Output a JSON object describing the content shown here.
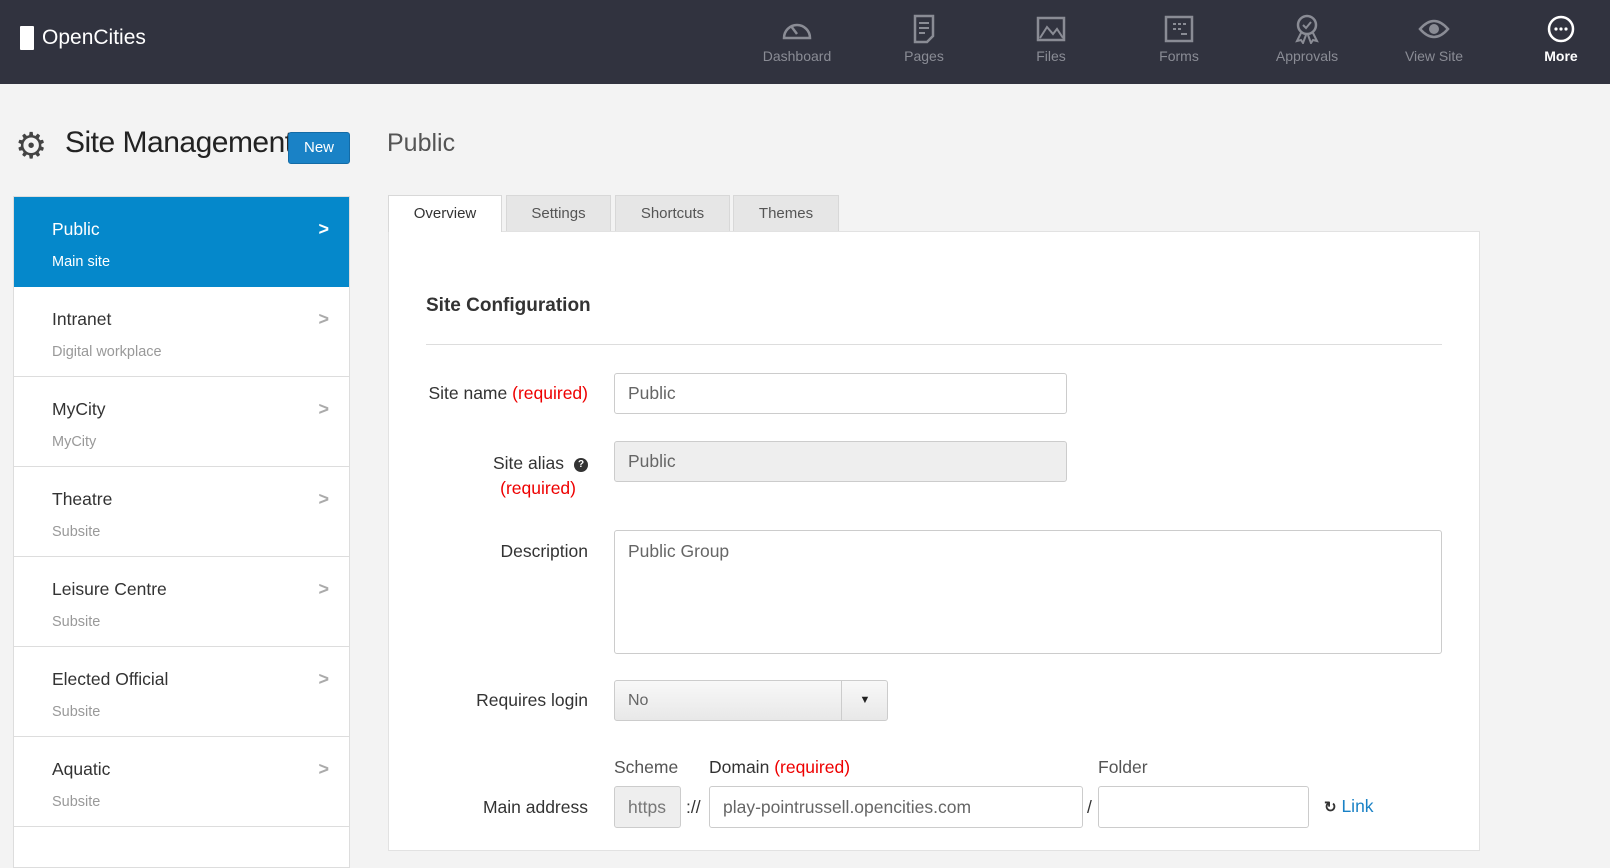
{
  "brand": "OpenCities",
  "nav": [
    {
      "label": "Dashboard",
      "icon": "dashboard-icon"
    },
    {
      "label": "Pages",
      "icon": "pages-icon"
    },
    {
      "label": "Files",
      "icon": "files-icon"
    },
    {
      "label": "Forms",
      "icon": "forms-icon"
    },
    {
      "label": "Approvals",
      "icon": "approvals-icon"
    },
    {
      "label": "View Site",
      "icon": "eye-icon"
    },
    {
      "label": "More",
      "icon": "more-icon"
    }
  ],
  "heading": "Site Management",
  "new_label": "New",
  "page_title": "Public",
  "sites": [
    {
      "title": "Public",
      "subtitle": "Main site"
    },
    {
      "title": "Intranet",
      "subtitle": "Digital workplace"
    },
    {
      "title": "MyCity",
      "subtitle": "MyCity"
    },
    {
      "title": "Theatre",
      "subtitle": "Subsite"
    },
    {
      "title": "Leisure Centre",
      "subtitle": "Subsite"
    },
    {
      "title": "Elected Official",
      "subtitle": "Subsite"
    },
    {
      "title": "Aquatic",
      "subtitle": "Subsite"
    }
  ],
  "tabs": [
    "Overview",
    "Settings",
    "Shortcuts",
    "Themes"
  ],
  "form": {
    "section": "Site Configuration",
    "required": "(required)",
    "site_name_label": "Site name",
    "site_name": "Public",
    "site_alias_label": "Site alias",
    "site_alias": "Public",
    "description_label": "Description",
    "description": "Public Group",
    "requires_login_label": "Requires login",
    "requires_login": "No",
    "main_address_label": "Main address",
    "scheme_label": "Scheme",
    "scheme": "https",
    "sep": "://",
    "domain_label": "Domain",
    "domain": "play-pointrussell.opencities.com",
    "slash": "/",
    "folder_label": "Folder",
    "folder": "",
    "link_label": "Link"
  }
}
